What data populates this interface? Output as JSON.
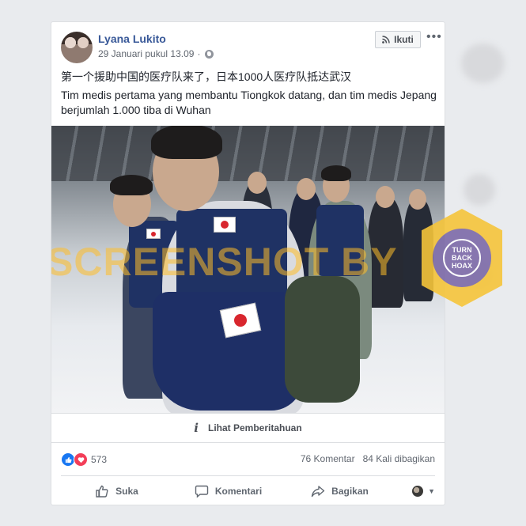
{
  "post": {
    "author_name": "Lyana Lukito",
    "timestamp": "29 Januari pukul 13.09",
    "separator": "·",
    "follow_label": "Ikuti",
    "more_label": "•••",
    "text_chinese": "第一个援助中国的医疗队来了，日本1000人医疗队抵达武汉",
    "text_indonesian": "Tim medis pertama yang membantu Tiongkok datang, dan tim medis Jepang berjumlah 1.000 tiba di Wuhan",
    "watermark": "SCREENSHOT BY",
    "notice_label": "Lihat Pemberitahuan",
    "reaction_count": "573",
    "comments_count": "76 Komentar",
    "shares_count": "84 Kali dibagikan",
    "actions": {
      "like": "Suka",
      "comment": "Komentari",
      "share": "Bagikan"
    }
  },
  "badge": {
    "top_text": "TURN",
    "middle_text": "BACK",
    "bottom_text": "HOAX"
  },
  "colors": {
    "link_blue": "#385898",
    "vest_blue": "#1f3264",
    "badge_yellow": "#f6c53a",
    "badge_purple": "#7d6aa8"
  }
}
